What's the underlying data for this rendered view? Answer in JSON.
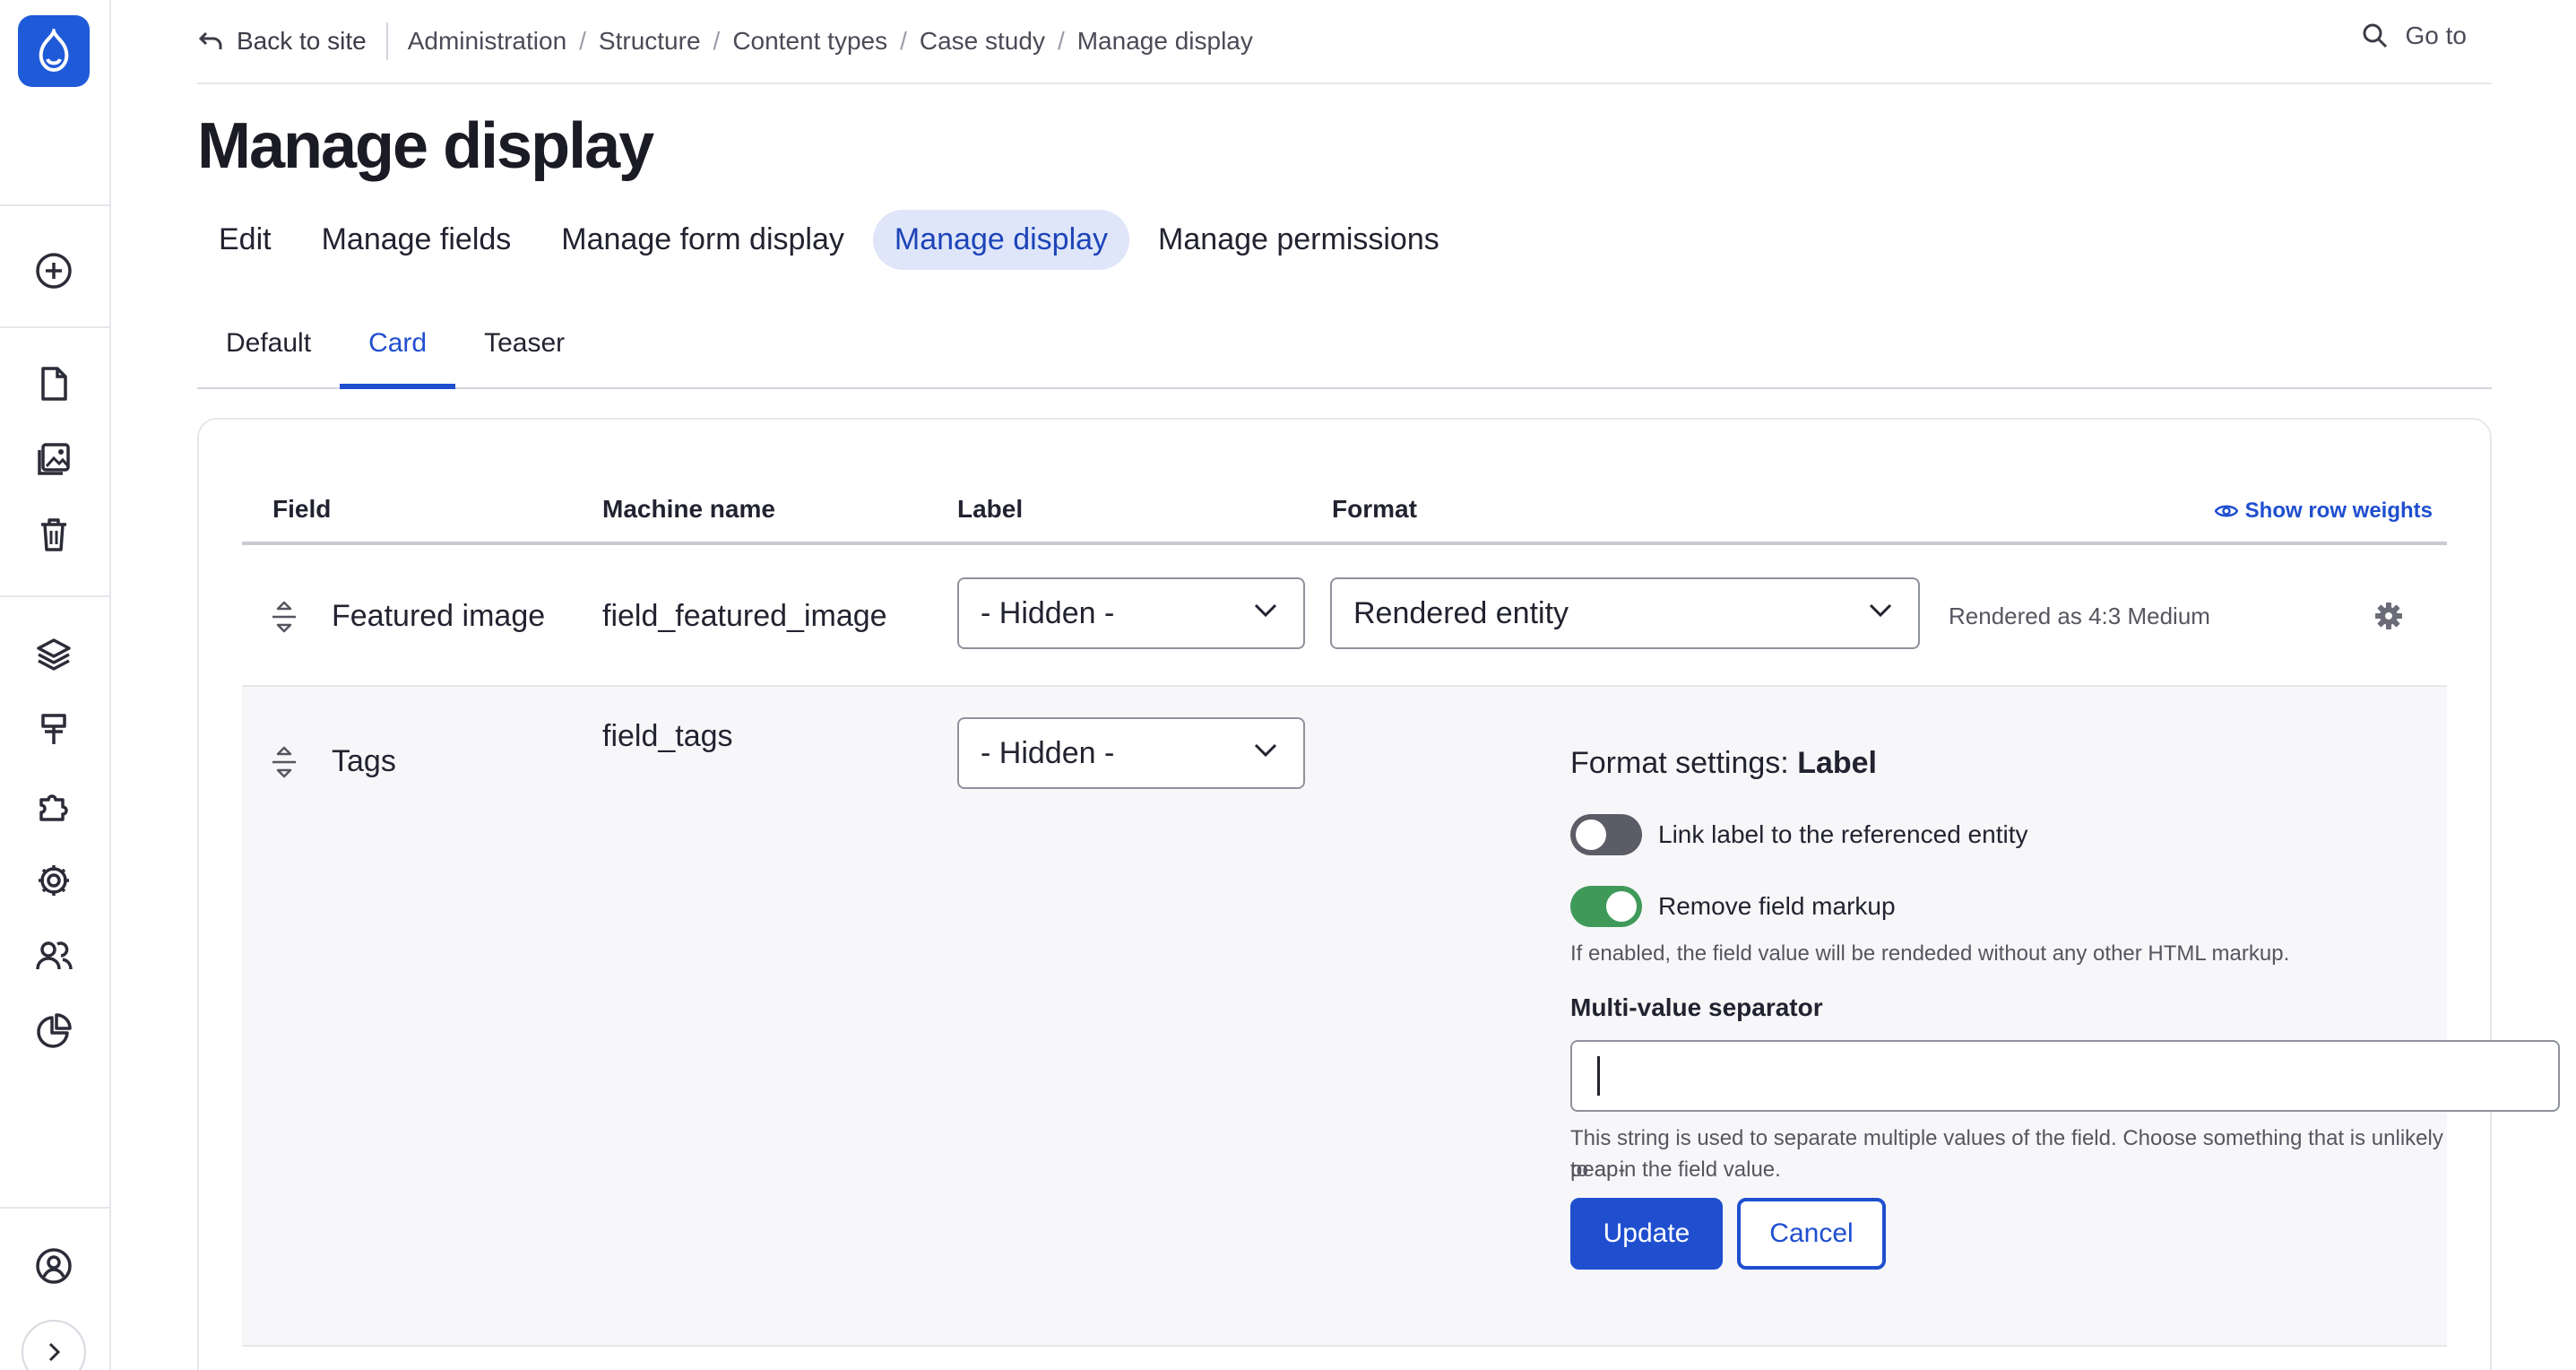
{
  "colors": {
    "accent": "#1f4fcf",
    "brand": "#1f5ad9",
    "toggle_on": "#3f9a5a",
    "toggle_off": "#5b5c66"
  },
  "toolbar": {
    "icons": [
      "drupal-logo-icon",
      "plus-circle-icon",
      "document-icon",
      "media-icon",
      "trash-icon",
      "layers-icon",
      "paint-icon",
      "extensions-icon",
      "gear-icon",
      "people-icon",
      "reports-icon",
      "user-icon",
      "expand-icon"
    ]
  },
  "topbar": {
    "back_label": "Back to site",
    "breadcrumbs": [
      "Administration",
      "Structure",
      "Content types",
      "Case study",
      "Manage display"
    ],
    "separator": "/",
    "goto_label": "Go to"
  },
  "page": {
    "title": "Manage display"
  },
  "primary_tabs": [
    "Edit",
    "Manage fields",
    "Manage form display",
    "Manage display",
    "Manage permissions"
  ],
  "primary_active": "Manage display",
  "secondary_tabs": [
    "Default",
    "Card",
    "Teaser"
  ],
  "secondary_active": "Card",
  "table": {
    "headers": {
      "field": "Field",
      "machine_name": "Machine name",
      "label": "Label",
      "format": "Format"
    },
    "show_row_weights": "Show row weights",
    "rows": [
      {
        "field": "Featured image",
        "machine_name": "field_featured_image",
        "label": "- Hidden -",
        "format": "Rendered entity",
        "summary": "Rendered as 4:3 Medium"
      },
      {
        "field": "Tags",
        "machine_name": "field_tags",
        "label": "- Hidden -",
        "format_settings_prefix": "Format settings:",
        "format_settings_name": "Label",
        "toggle_link": {
          "label": "Link label to the referenced entity",
          "state": "off"
        },
        "toggle_markup": {
          "label": "Remove field markup",
          "state": "on"
        },
        "markup_help": "If enabled, the field value will be rendeded without any other HTML markup.",
        "separator_label": "Multi-value separator",
        "separator_value": "",
        "separator_help_line1": "This string is used to separate multiple values of the field. Choose something that is unlikely to ap-",
        "separator_help_line2": "pear in the field value.",
        "update_label": "Update",
        "cancel_label": "Cancel"
      }
    ]
  }
}
